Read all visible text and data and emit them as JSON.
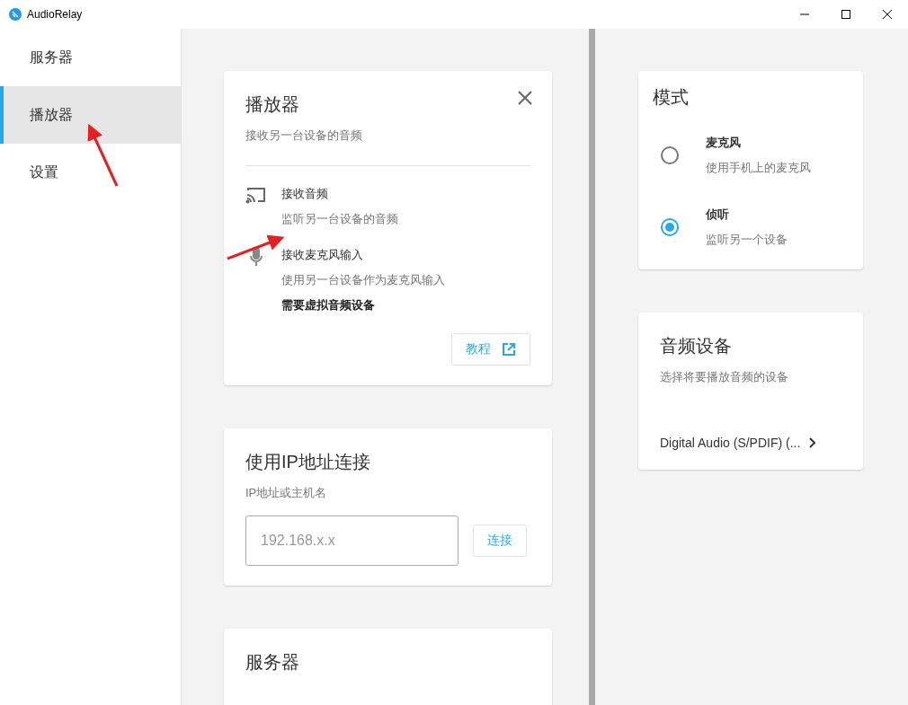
{
  "window": {
    "title": "AudioRelay"
  },
  "sidebar": {
    "items": [
      {
        "label": "服务器",
        "selected": false
      },
      {
        "label": "播放器",
        "selected": true
      },
      {
        "label": "设置",
        "selected": false
      }
    ]
  },
  "player_card": {
    "title": "播放器",
    "subtitle": "接收另一台设备的音频",
    "options": [
      {
        "kind": "cast",
        "title": "接收音频",
        "description": "监听另一台设备的音频"
      },
      {
        "kind": "mic",
        "title": "接收麦克风输入",
        "description": "使用另一台设备作为麦克风输入",
        "note": "需要虚拟音频设备"
      }
    ],
    "tutorial_button": "教程"
  },
  "ip_card": {
    "title": "使用IP地址连接",
    "label": "IP地址或主机名",
    "placeholder": "192.168.x.x",
    "connect_button": "连接"
  },
  "server_card": {
    "title": "服务器"
  },
  "mode_card": {
    "title": "模式",
    "options": [
      {
        "title": "麦克风",
        "description": "使用手机上的麦克风",
        "selected": false
      },
      {
        "title": "侦听",
        "description": "监听另一个设备",
        "selected": true
      }
    ]
  },
  "audio_device_card": {
    "title": "音频设备",
    "subtitle": "选择将要播放音频的设备",
    "device": "Digital Audio (S/PDIF) (..."
  }
}
